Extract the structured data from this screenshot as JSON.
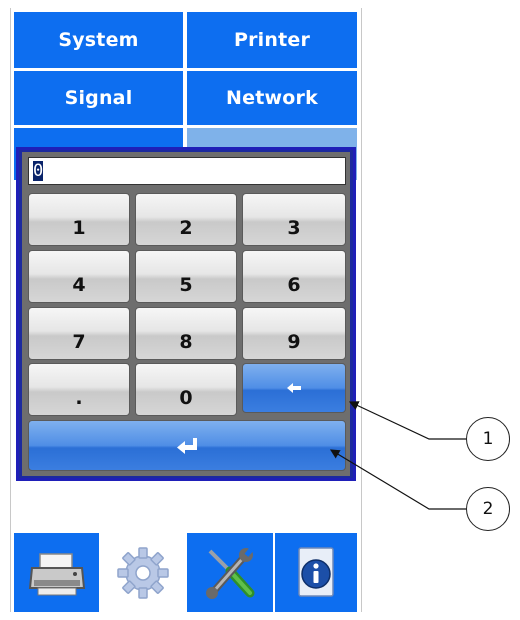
{
  "menu": {
    "system": "System",
    "printer": "Printer",
    "signal": "Signal",
    "network": "Network"
  },
  "entry": {
    "value": "0"
  },
  "keypad": {
    "keys": [
      "1",
      "2",
      "3",
      "4",
      "5",
      "6",
      "7",
      "8",
      "9",
      ".",
      "0"
    ],
    "backspace_icon": "backspace-arrow-icon",
    "enter_icon": "enter-return-icon"
  },
  "tabs": [
    {
      "name": "printer-icon",
      "selected": true
    },
    {
      "name": "gear-icon",
      "selected": false
    },
    {
      "name": "tools-icon",
      "selected": true
    },
    {
      "name": "info-icon",
      "selected": true
    }
  ],
  "callouts": [
    "1",
    "2"
  ],
  "colors": {
    "menu_blue": "#0d6ef0",
    "keypad_border": "#1c2a9e",
    "key_blue": "#3b7ee0"
  }
}
